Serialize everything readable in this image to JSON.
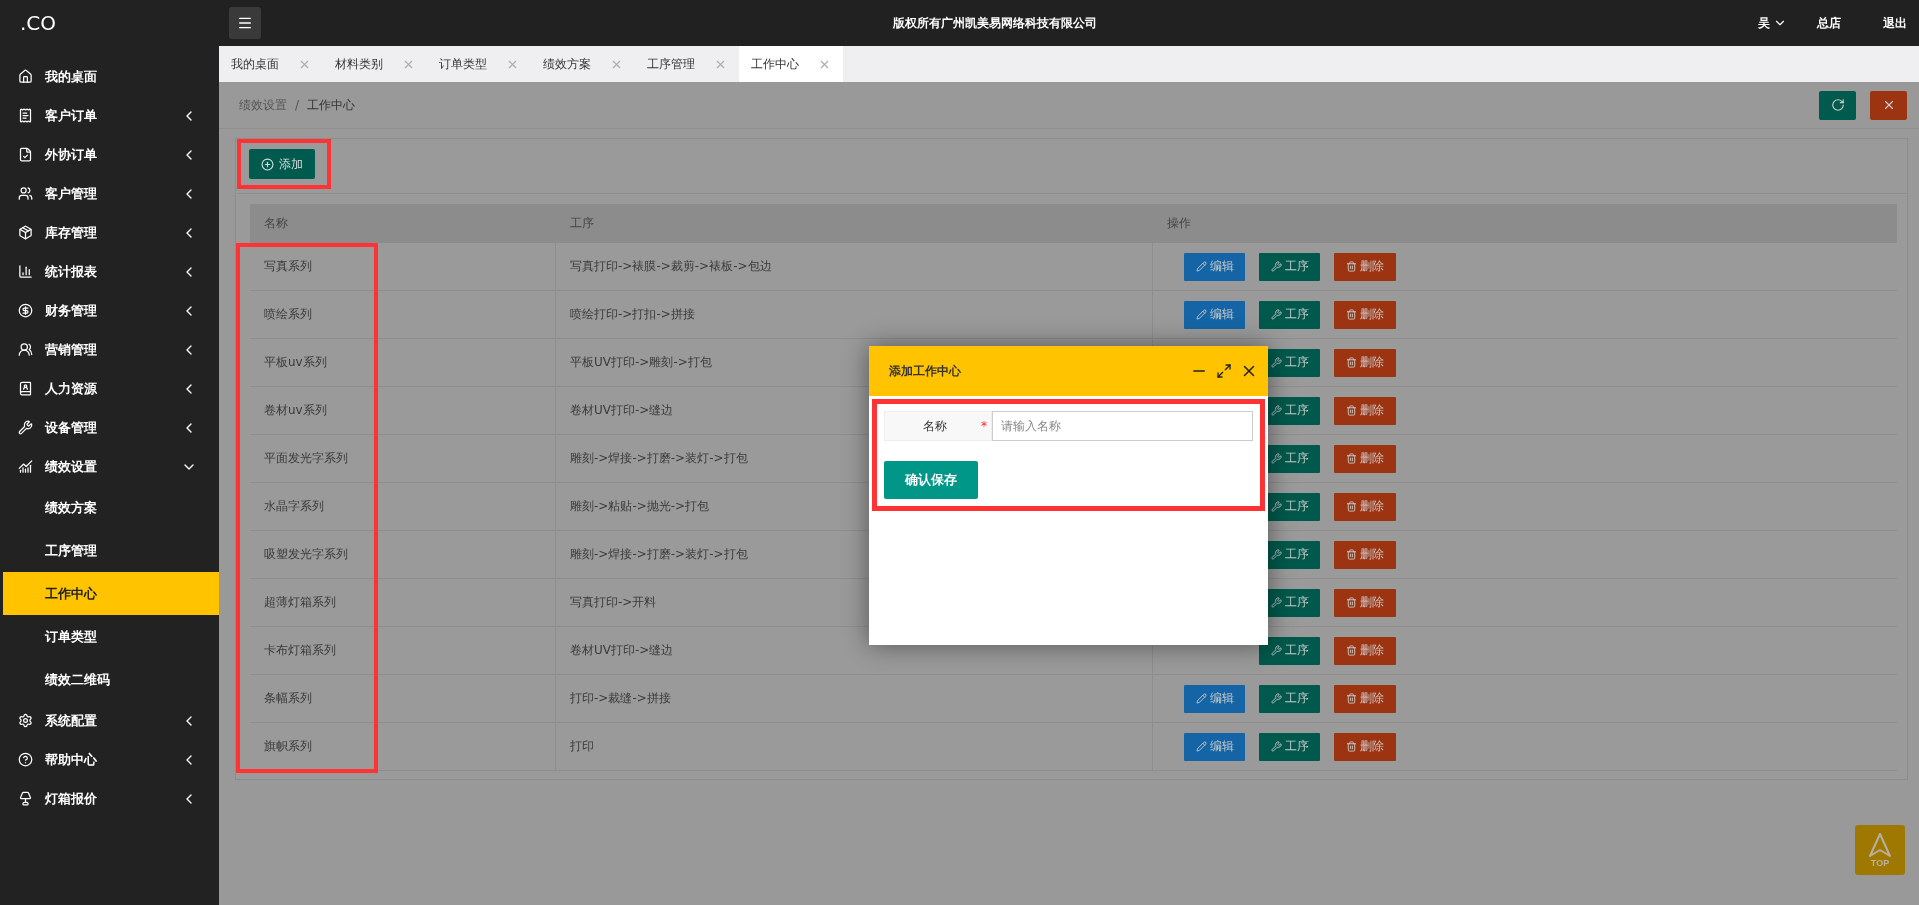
{
  "sidebar": {
    "logo": ".CO",
    "items": [
      {
        "kind": "link",
        "label": "我的桌面"
      },
      {
        "kind": "group",
        "label": "客户订单",
        "expanded": false
      },
      {
        "kind": "group",
        "label": "外协订单",
        "expanded": false
      },
      {
        "kind": "group",
        "label": "客户管理",
        "expanded": false
      },
      {
        "kind": "group",
        "label": "库存管理",
        "expanded": false
      },
      {
        "kind": "group",
        "label": "统计报表",
        "expanded": false
      },
      {
        "kind": "group",
        "label": "财务管理",
        "expanded": false
      },
      {
        "kind": "group",
        "label": "营销管理",
        "expanded": false
      },
      {
        "kind": "group",
        "label": "人力资源",
        "expanded": false
      },
      {
        "kind": "group",
        "label": "设备管理",
        "expanded": false
      },
      {
        "kind": "group",
        "label": "绩效设置",
        "expanded": true,
        "children": [
          {
            "label": "绩效方案",
            "selected": false
          },
          {
            "label": "工序管理",
            "selected": false
          },
          {
            "label": "工作中心",
            "selected": true
          },
          {
            "label": "订单类型",
            "selected": false
          },
          {
            "label": "绩效二维码",
            "selected": false
          }
        ]
      },
      {
        "kind": "group",
        "label": "系统配置",
        "expanded": false
      },
      {
        "kind": "group",
        "label": "帮助中心",
        "expanded": false
      },
      {
        "kind": "group",
        "label": "灯箱报价",
        "expanded": false
      }
    ]
  },
  "topbar": {
    "title": "版权所有广州凯美易网络科技有限公司",
    "user": "吴",
    "store": "总店",
    "logout": "退出"
  },
  "tabs": [
    {
      "label": "我的桌面",
      "selected": false
    },
    {
      "label": "材料类别",
      "selected": false
    },
    {
      "label": "订单类型",
      "selected": false
    },
    {
      "label": "绩效方案",
      "selected": false
    },
    {
      "label": "工序管理",
      "selected": false
    },
    {
      "label": "工作中心",
      "selected": true
    }
  ],
  "breadcrumb": [
    "绩效设置",
    "工作中心"
  ],
  "separator": "/",
  "toolbar": {
    "add_button": {
      "label": "添加",
      "highlighted": true
    }
  },
  "table": {
    "name_column_highlighted": true,
    "columns": [
      {
        "label": "名称"
      },
      {
        "label": "工序"
      },
      {
        "label": "操作"
      }
    ],
    "rows": [
      {
        "name": "写真系列",
        "process": "写真打印->裱膜->裁剪->裱板->包边",
        "actions": [
          {
            "kind": "edit",
            "label": "编辑"
          },
          {
            "kind": "process",
            "label": "工序"
          },
          {
            "kind": "delete",
            "label": "删除"
          }
        ]
      },
      {
        "name": "喷绘系列",
        "process": "喷绘打印->打扣->拼接",
        "actions": [
          {
            "kind": "edit",
            "label": "编辑"
          },
          {
            "kind": "process",
            "label": "工序"
          },
          {
            "kind": "delete",
            "label": "删除"
          }
        ]
      },
      {
        "name": "平板uv系列",
        "process": "平板UV打印->雕刻->打包",
        "actions": [
          {
            "kind": "process",
            "label": "工序"
          },
          {
            "kind": "delete",
            "label": "删除"
          }
        ]
      },
      {
        "name": "卷材uv系列",
        "process": "卷材UV打印->缝边",
        "actions": [
          {
            "kind": "process",
            "label": "工序"
          },
          {
            "kind": "delete",
            "label": "删除"
          }
        ]
      },
      {
        "name": "平面发光字系列",
        "process": "雕刻->焊接->打磨->装灯->打包",
        "actions": [
          {
            "kind": "process",
            "label": "工序"
          },
          {
            "kind": "delete",
            "label": "删除"
          }
        ]
      },
      {
        "name": "水晶字系列",
        "process": "雕刻->粘贴->抛光->打包",
        "actions": [
          {
            "kind": "process",
            "label": "工序"
          },
          {
            "kind": "delete",
            "label": "删除"
          }
        ]
      },
      {
        "name": "吸塑发光字系列",
        "process": "雕刻->焊接->打磨->装灯->打包",
        "actions": [
          {
            "kind": "process",
            "label": "工序"
          },
          {
            "kind": "delete",
            "label": "删除"
          }
        ]
      },
      {
        "name": "超薄灯箱系列",
        "process": "写真打印->开料",
        "actions": [
          {
            "kind": "process",
            "label": "工序"
          },
          {
            "kind": "delete",
            "label": "删除"
          }
        ]
      },
      {
        "name": "卡布灯箱系列",
        "process": "卷材UV打印->缝边",
        "actions": [
          {
            "kind": "process",
            "label": "工序"
          },
          {
            "kind": "delete",
            "label": "删除"
          }
        ]
      },
      {
        "name": "条幅系列",
        "process": "打印->裁缝->拼接",
        "actions": [
          {
            "kind": "edit",
            "label": "编辑"
          },
          {
            "kind": "process",
            "label": "工序"
          },
          {
            "kind": "delete",
            "label": "删除"
          }
        ]
      },
      {
        "name": "旗帜系列",
        "process": "打印",
        "actions": [
          {
            "kind": "edit",
            "label": "编辑"
          },
          {
            "kind": "process",
            "label": "工序"
          },
          {
            "kind": "delete",
            "label": "删除"
          }
        ]
      }
    ]
  },
  "dialog": {
    "title": "添加工作中心",
    "form": {
      "highlighted": true,
      "label": "名称",
      "required_mark": "*",
      "placeholder": "请输入名称",
      "submit": "确认保存"
    }
  },
  "back_to_top": {
    "label": "TOP"
  }
}
